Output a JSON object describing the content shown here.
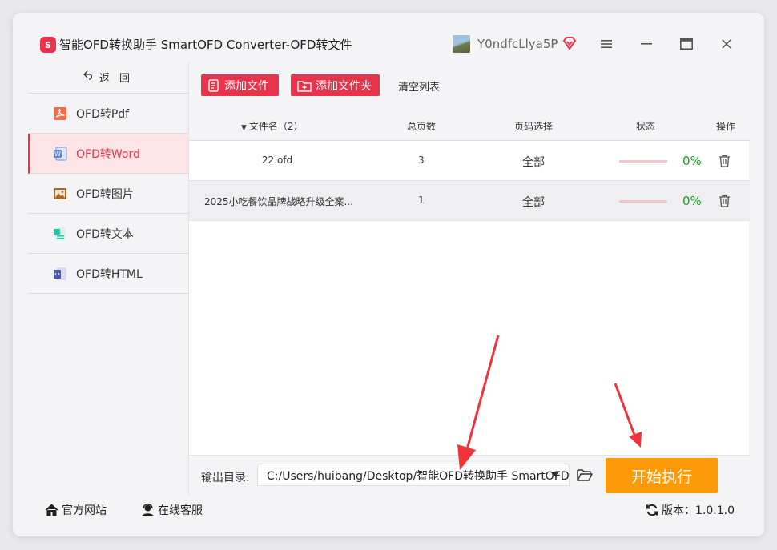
{
  "app": {
    "logo_text": "S",
    "title": "智能OFD转换助手 SmartOFD Converter-OFD转文件",
    "username": "Y0ndfcLlya5P"
  },
  "sidebar": {
    "back_label": "返 回",
    "items": [
      {
        "label": "OFD转Pdf",
        "icon": "pdf-icon",
        "active": false
      },
      {
        "label": "OFD转Word",
        "icon": "word-icon",
        "active": true
      },
      {
        "label": "OFD转图片",
        "icon": "image-icon",
        "active": false
      },
      {
        "label": "OFD转文本",
        "icon": "text-icon",
        "active": false
      },
      {
        "label": "OFD转HTML",
        "icon": "html-icon",
        "active": false
      }
    ]
  },
  "toolbar": {
    "add_file": "添加文件",
    "add_folder": "添加文件夹",
    "clear_list": "清空列表"
  },
  "table": {
    "headers": {
      "filename": "文件名（2）",
      "pages": "总页数",
      "page_select": "页码选择",
      "status": "状态",
      "action": "操作"
    },
    "rows": [
      {
        "filename": "22.ofd",
        "pages": "3",
        "page_select": "全部",
        "progress": "0%"
      },
      {
        "filename": "2025小吃餐饮品牌战略升级全案...",
        "pages": "1",
        "page_select": "全部",
        "progress": "0%"
      }
    ]
  },
  "output": {
    "label": "输出目录:",
    "path": "C:/Users/huibang/Desktop/智能OFD转换助手 SmartOFD Converter",
    "start_label": "开始执行"
  },
  "statusbar": {
    "website": "官方网站",
    "support": "在线客服",
    "version": "版本：1.0.1.0"
  },
  "colors": {
    "accent": "#e8334a",
    "start_button": "#fb9a06",
    "progress_text": "#15a21d",
    "arrow": "#f2323a"
  }
}
